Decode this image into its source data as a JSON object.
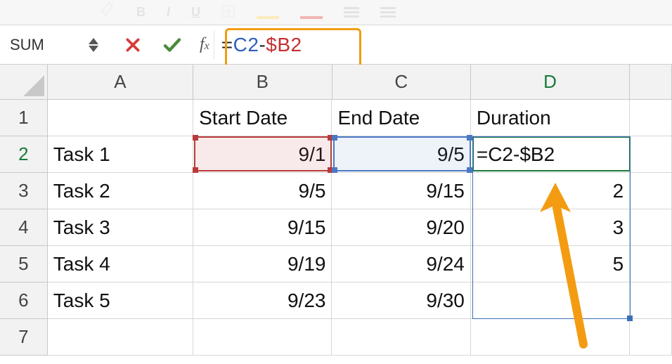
{
  "nameBox": "SUM",
  "formula": {
    "eq": "=",
    "ref1": "C2",
    "op": "-",
    "ref2": "$B2"
  },
  "columns": [
    "A",
    "B",
    "C",
    "D"
  ],
  "rows": [
    "1",
    "2",
    "3",
    "4",
    "5",
    "6",
    "7"
  ],
  "headers": {
    "b": "Start Date",
    "c": "End Date",
    "d": "Duration"
  },
  "data": {
    "r2": {
      "a": "Task 1",
      "b": "9/1",
      "c": "9/5",
      "d": "=C2-$B2"
    },
    "r3": {
      "a": "Task 2",
      "b": "9/5",
      "c": "9/15",
      "d": "2"
    },
    "r4": {
      "a": "Task 3",
      "b": "9/15",
      "c": "9/20",
      "d": "3"
    },
    "r5": {
      "a": "Task 4",
      "b": "9/19",
      "c": "9/24",
      "d": "5"
    },
    "r6": {
      "a": "Task 5",
      "b": "9/23",
      "c": "9/30",
      "d": ""
    }
  },
  "colors": {
    "highlightBox": "#F39C12",
    "refRed": "#b93a3a",
    "refBlue": "#4a78c4",
    "activeGreen": "#1b7a3a"
  }
}
